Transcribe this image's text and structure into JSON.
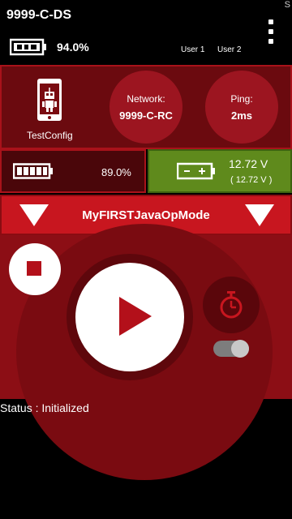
{
  "header": {
    "title": "9999-C-DS",
    "corner_letter": "S",
    "ds_battery_percent": "94.0%",
    "user1": "User 1",
    "user2": "User 2"
  },
  "config": {
    "name": "TestConfig"
  },
  "network": {
    "label": "Network:",
    "value": "9999-C-RC"
  },
  "ping": {
    "label": "Ping:",
    "value": "2ms"
  },
  "robot_battery": {
    "percent": "89.0%"
  },
  "voltage": {
    "main": "12.72 V",
    "sub": "( 12.72 V )"
  },
  "opmode": {
    "name": "MyFIRSTJavaOpMode"
  },
  "status": {
    "text": "Status : Initialized"
  },
  "colors": {
    "panel_dark": "#6b0a0f",
    "accent_red": "#c8161f",
    "voltage_green": "#5f8a1c"
  },
  "icons": {
    "menu": "overflow-menu-icon",
    "ds_battery": "phone-battery-icon",
    "robot": "robot-phone-icon",
    "robot_battery": "robot-battery-icon",
    "voltage_battery": "voltage-battery-icon",
    "timer": "timer-icon"
  }
}
